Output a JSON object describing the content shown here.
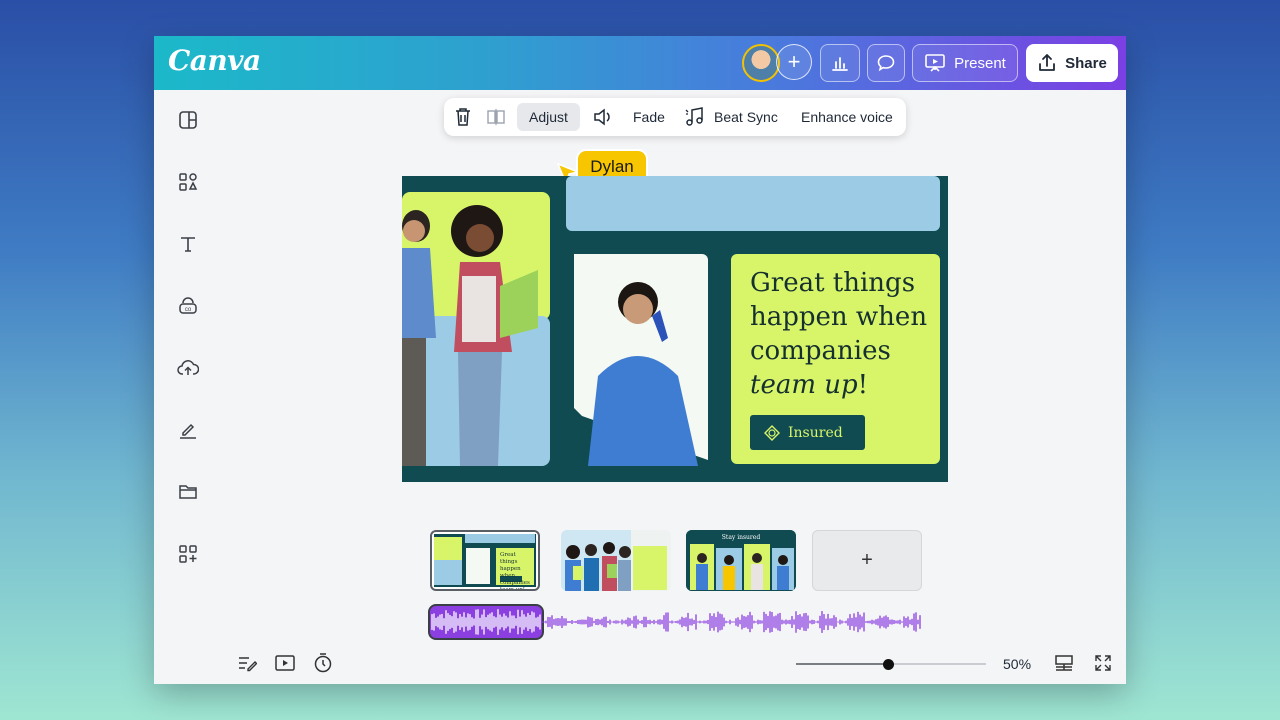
{
  "app": {
    "logo": "Canva"
  },
  "header": {
    "present_label": "Present",
    "share_label": "Share"
  },
  "context_toolbar": {
    "adjust_label": "Adjust",
    "fade_label": "Fade",
    "beat_sync_label": "Beat Sync",
    "enhance_voice_label": "Enhance voice"
  },
  "collaborator_cursor": {
    "name": "Dylan",
    "color": "#f7c600"
  },
  "canvas": {
    "headline_line1": "Great things",
    "headline_line2": "happen when",
    "headline_line3": "companies",
    "headline_line4_italic": "team up",
    "headline_line4_end": "!",
    "badge_label": "Insured"
  },
  "pages": {
    "thumb1_text": "Great things happen when companies team up!",
    "thumb3_title": "Stay insured",
    "add_page": "+"
  },
  "footer": {
    "zoom": "50%",
    "zoom_fraction": 0.5
  },
  "colors": {
    "accent_purple": "#8b3fe0",
    "lime": "#d8f56a",
    "teal": "#0f4b50",
    "sky": "#9ccbe6"
  }
}
